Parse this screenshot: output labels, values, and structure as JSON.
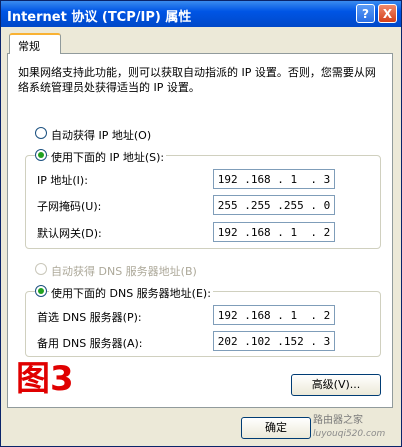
{
  "window": {
    "title": "Internet 协议 (TCP/IP) 属性",
    "help_label": "?",
    "close_label": "X"
  },
  "tab": {
    "label": "常规"
  },
  "description": "如果网络支持此功能，则可以获取自动指派的 IP 设置。否则，您需要从网络系统管理员处获得适当的 IP 设置。",
  "ip_section": {
    "auto_label": "自动获得 IP 地址(O)",
    "manual_label": "使用下面的 IP 地址(S):",
    "fields": [
      {
        "label": "IP 地址(I):",
        "value": "192 .168 . 1  . 3"
      },
      {
        "label": "子网掩码(U):",
        "value": "255 .255 .255 . 0"
      },
      {
        "label": "默认网关(D):",
        "value": "192 .168 . 1  . 2"
      }
    ]
  },
  "dns_section": {
    "auto_label": "自动获得 DNS 服务器地址(B)",
    "manual_label": "使用下面的 DNS 服务器地址(E):",
    "fields": [
      {
        "label": "首选 DNS 服务器(P):",
        "value": "192 .168 . 1  . 2"
      },
      {
        "label": "备用 DNS 服务器(A):",
        "value": "202 .102 .152 . 3"
      }
    ]
  },
  "buttons": {
    "advanced": "高级(V)...",
    "ok": "确定"
  },
  "overlay": {
    "figure_label": "图3"
  },
  "watermark": {
    "line1": "路由器之家",
    "line2": "luyouqi520.com"
  },
  "colors": {
    "titlebar": "#0055e5",
    "figure_label": "#e00000"
  }
}
